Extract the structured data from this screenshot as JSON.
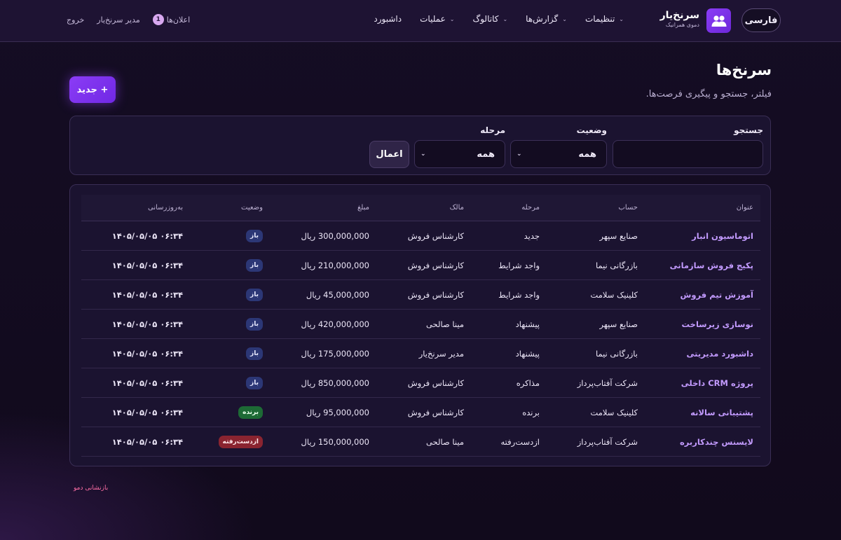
{
  "header": {
    "language_label": "فارسی",
    "brand_name": "سرنخ‌یار",
    "brand_sub": "دموی همرانیک",
    "nav": [
      {
        "label": "داشبورد",
        "has_dropdown": false
      },
      {
        "label": "عملیات",
        "has_dropdown": true
      },
      {
        "label": "کاتالوگ",
        "has_dropdown": true
      },
      {
        "label": "گزارش‌ها",
        "has_dropdown": true
      },
      {
        "label": "تنظیمات",
        "has_dropdown": true
      }
    ],
    "notifications_label": "اعلان‌ها",
    "notifications_count": "1",
    "user_label": "مدیر سرنخ‌یار",
    "logout_label": "خروج"
  },
  "page": {
    "title": "سرنخ‌ها",
    "subtitle": "فیلتر، جستجو و پیگیری فرصت‌ها.",
    "new_button": "+ جدید"
  },
  "filters": {
    "search_label": "جستجو",
    "search_value": "",
    "status_label": "وضعیت",
    "status_value": "همه",
    "stage_label": "مرحله",
    "stage_value": "همه",
    "apply_label": "اعمال"
  },
  "table": {
    "columns": {
      "title": "عنوان",
      "account": "حساب",
      "stage": "مرحله",
      "owner": "مالک",
      "amount": "مبلغ",
      "status": "وضعیت",
      "updated": "به‌روزرسانی"
    },
    "rows": [
      {
        "title": "اتوماسیون انبار",
        "account": "صنایع سپهر",
        "stage": "جدید",
        "owner": "کارشناس فروش",
        "amount": "300,000,000 ریال",
        "status": "باز",
        "status_kind": "open",
        "updated": "۱۴۰۵/۰۵/۰۵ ۰۶:۳۴"
      },
      {
        "title": "پکیج فروش سازمانی",
        "account": "بازرگانی نیما",
        "stage": "واجد شرایط",
        "owner": "کارشناس فروش",
        "amount": "210,000,000 ریال",
        "status": "باز",
        "status_kind": "open",
        "updated": "۱۴۰۵/۰۵/۰۵ ۰۶:۳۴"
      },
      {
        "title": "آموزش تیم فروش",
        "account": "کلینیک سلامت",
        "stage": "واجد شرایط",
        "owner": "کارشناس فروش",
        "amount": "45,000,000 ریال",
        "status": "باز",
        "status_kind": "open",
        "updated": "۱۴۰۵/۰۵/۰۵ ۰۶:۳۴"
      },
      {
        "title": "نوسازی زیرساخت",
        "account": "صنایع سپهر",
        "stage": "پیشنهاد",
        "owner": "مینا صالحی",
        "amount": "420,000,000 ریال",
        "status": "باز",
        "status_kind": "open",
        "updated": "۱۴۰۵/۰۵/۰۵ ۰۶:۳۴"
      },
      {
        "title": "داشبورد مدیریتی",
        "account": "بازرگانی نیما",
        "stage": "پیشنهاد",
        "owner": "مدیر سرنخ‌یار",
        "amount": "175,000,000 ریال",
        "status": "باز",
        "status_kind": "open",
        "updated": "۱۴۰۵/۰۵/۰۵ ۰۶:۳۴"
      },
      {
        "title": "پروژه CRM داخلی",
        "account": "شرکت آفتاب‌پرداز",
        "stage": "مذاکره",
        "owner": "کارشناس فروش",
        "amount": "850,000,000 ریال",
        "status": "باز",
        "status_kind": "open",
        "updated": "۱۴۰۵/۰۵/۰۵ ۰۶:۳۴"
      },
      {
        "title": "پشتیبانی سالانه",
        "account": "کلینیک سلامت",
        "stage": "برنده",
        "owner": "کارشناس فروش",
        "amount": "95,000,000 ریال",
        "status": "برنده",
        "status_kind": "won",
        "updated": "۱۴۰۵/۰۵/۰۵ ۰۶:۳۴"
      },
      {
        "title": "لایسنس چندکاربره",
        "account": "شرکت آفتاب‌پرداز",
        "stage": "ازدست‌رفته",
        "owner": "مینا صالحی",
        "amount": "150,000,000 ریال",
        "status": "ازدست‌رفته",
        "status_kind": "lost",
        "updated": "۱۴۰۵/۰۵/۰۵ ۰۶:۳۴"
      }
    ]
  },
  "footer": {
    "reset_label": "بازنشانی دمو"
  }
}
